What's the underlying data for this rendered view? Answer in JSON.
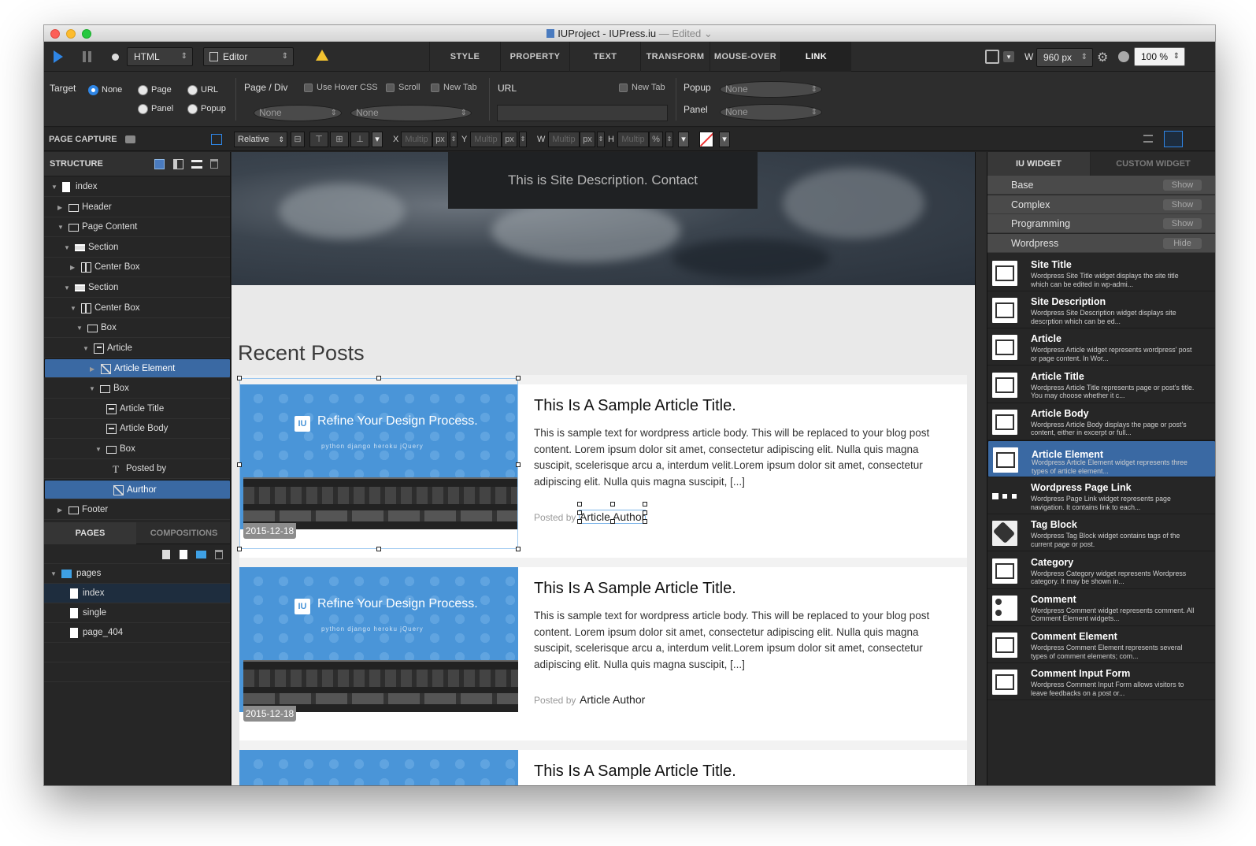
{
  "window": {
    "title": "IUProject - IUPress.iu",
    "status": "— Edited"
  },
  "toolbar": {
    "doc_type": "HTML",
    "mode": "Editor",
    "tabs": [
      "STYLE",
      "PROPERTY",
      "TEXT",
      "TRANSFORM",
      "MOUSE-OVER",
      "LINK"
    ],
    "width_label": "W",
    "width_value": "960 px",
    "zoom": "100 %"
  },
  "link_panel": {
    "target_label": "Target",
    "target_options": [
      "None",
      "Page",
      "URL",
      "Panel",
      "Popup"
    ],
    "page_div_label": "Page / Div",
    "use_hover_css": "Use Hover CSS",
    "scroll": "Scroll",
    "new_tab": "New Tab",
    "page_select": "None",
    "div_select": "None",
    "url_label": "URL",
    "url_new_tab": "New Tab",
    "popup_label": "Popup",
    "popup_value": "None",
    "panel_label": "Panel",
    "panel_value": "None"
  },
  "position_bar": {
    "page_capture": "PAGE CAPTURE",
    "position_mode": "Relative",
    "x_label": "X",
    "y_label": "Y",
    "w_label": "W",
    "h_label": "H",
    "placeholder": "Multip",
    "unit_px": "px",
    "unit_pct": "%"
  },
  "structure": {
    "header": "STRUCTURE",
    "items": [
      {
        "label": "index",
        "depth": 0
      },
      {
        "label": "Header",
        "depth": 1
      },
      {
        "label": "Page Content",
        "depth": 1
      },
      {
        "label": "Section",
        "depth": 2
      },
      {
        "label": "Center Box",
        "depth": 3
      },
      {
        "label": "Section",
        "depth": 2
      },
      {
        "label": "Center Box",
        "depth": 3
      },
      {
        "label": "Box",
        "depth": 4
      },
      {
        "label": "Article",
        "depth": 5
      },
      {
        "label": "Article Element",
        "depth": 6
      },
      {
        "label": "Box",
        "depth": 6
      },
      {
        "label": "Article Title",
        "depth": 7
      },
      {
        "label": "Article Body",
        "depth": 7
      },
      {
        "label": "Box",
        "depth": 7
      },
      {
        "label": "Posted by",
        "depth": 8
      },
      {
        "label": "Aurthor",
        "depth": 8
      },
      {
        "label": "Footer",
        "depth": 1
      }
    ]
  },
  "pages": {
    "tab_pages": "PAGES",
    "tab_compositions": "COMPOSITIONS",
    "folder": "pages",
    "items": [
      "index",
      "single",
      "page_404"
    ]
  },
  "canvas": {
    "site_description": "This is Site Description. Contact",
    "recent_posts": "Recent Posts",
    "posts": [
      {
        "title": "This Is A Sample Article Title.",
        "body": "This is sample text for wordpress article body. This will be replaced to your blog post content. Lorem ipsum dolor sit amet, consectetur adipiscing elit. Nulla quis magna suscipit, scelerisque arcu a, interdum velit.Lorem ipsum dolor sit amet, consectetur adipiscing elit. Nulla quis magna suscipit, [...]",
        "posted_by": "Posted by",
        "author": "Article Author",
        "date": "2015-12-18",
        "thumb_text": "Refine Your Design Process.",
        "thumb_badge": "IU",
        "thumb_logos": "python   django   heroku   jQuery"
      },
      {
        "title": "This Is A Sample Article Title.",
        "body": "This is sample text for wordpress article body. This will be replaced to your blog post content. Lorem ipsum dolor sit amet, consectetur adipiscing elit. Nulla quis magna suscipit, scelerisque arcu a, interdum velit.Lorem ipsum dolor sit amet, consectetur adipiscing elit. Nulla quis magna suscipit, [...]",
        "posted_by": "Posted by",
        "author": "Article Author",
        "date": "2015-12-18",
        "thumb_text": "Refine Your Design Process.",
        "thumb_badge": "IU",
        "thumb_logos": "python   django   heroku   jQuery"
      },
      {
        "title": "This Is A Sample Article Title."
      }
    ]
  },
  "widgets": {
    "tab_iu": "IU WIDGET",
    "tab_custom": "CUSTOM WIDGET",
    "categories": [
      {
        "name": "Base",
        "action": "Show"
      },
      {
        "name": "Complex",
        "action": "Show"
      },
      {
        "name": "Programming",
        "action": "Show"
      },
      {
        "name": "Wordpress",
        "action": "Hide"
      }
    ],
    "items": [
      {
        "name": "Site Title",
        "desc": "Wordpress Site Title widget displays the site title which can be edited in wp-admi..."
      },
      {
        "name": "Site Description",
        "desc": "Wordpress Site Description widget displays site descrption which can be ed..."
      },
      {
        "name": "Article",
        "desc": "Wordpress Article widget represents wordpress' post or page content. In Wor..."
      },
      {
        "name": "Article Title",
        "desc": "Wordpress Article Title represents page or post's title. You may choose whether it c..."
      },
      {
        "name": "Article Body",
        "desc": "Wordpress Article Body displays the page or post's content, either in excerpt or full..."
      },
      {
        "name": "Article Element",
        "desc": "Wordpress Article Element widget represents three types of article element..."
      },
      {
        "name": "Wordpress Page Link",
        "desc": "Wordpress Page Link widget represents page navigation. It contains link to each..."
      },
      {
        "name": "Tag Block",
        "desc": "Wordpress Tag Block widget contains tags of the current page or post."
      },
      {
        "name": "Category",
        "desc": "Wordpress Category widget represents Wordpress category. It may be shown in..."
      },
      {
        "name": "Comment",
        "desc": "Wordpress Comment widget represents comment. All Comment Element widgets..."
      },
      {
        "name": "Comment Element",
        "desc": "Wordpress Comment Element represents several types of comment elements; com..."
      },
      {
        "name": "Comment Input Form",
        "desc": "Wordpress Comment Input Form allows visitors to leave feedbacks on a post or..."
      }
    ]
  },
  "colors": {
    "accent": "#3a69a3",
    "selection": "#2f86e6",
    "panel": "#262626"
  }
}
